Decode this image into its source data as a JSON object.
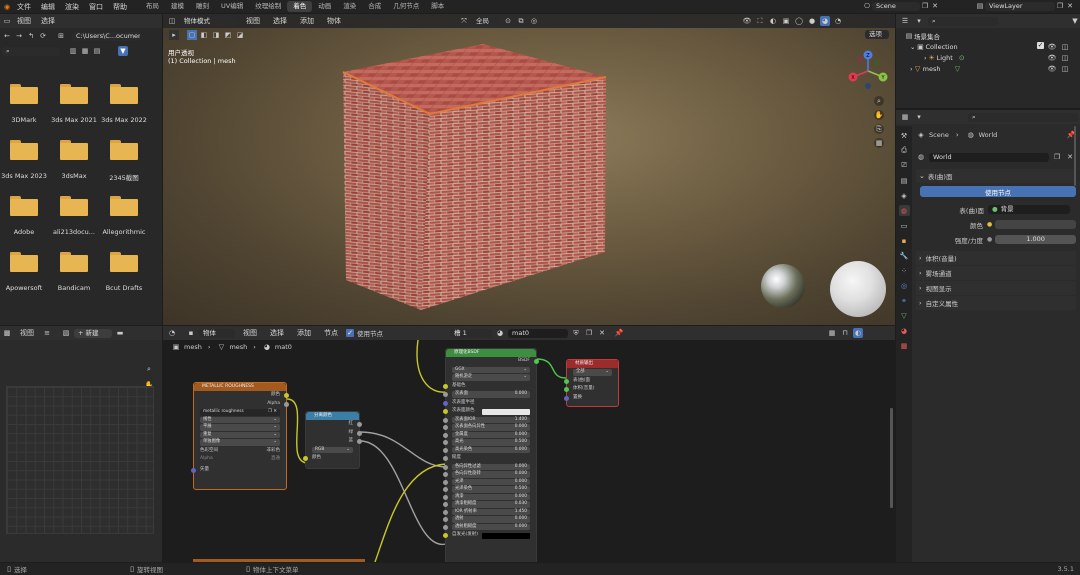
{
  "topbar": {
    "menus": [
      "文件",
      "编辑",
      "渲染",
      "窗口",
      "帮助"
    ],
    "workspaces": [
      "布局",
      "建模",
      "雕刻",
      "UV编辑",
      "纹理绘制",
      "着色",
      "动画",
      "渲染",
      "合成",
      "几何节点",
      "脚本"
    ],
    "active_workspace_index": 5,
    "scene": "Scene",
    "view_layer": "ViewLayer"
  },
  "file_browser": {
    "header_items": [
      "视图",
      "选择"
    ],
    "path": "C:\\Users\\C...ocuments\\",
    "folders": [
      "3DMark",
      "3ds Max 2021",
      "3ds Max 2022",
      "3ds Max 2023",
      "3dsMax",
      "2345截图",
      "Adobe",
      "ali213docu...",
      "Allegorithmic",
      "Apowersoft",
      "Bandicam",
      "Bcut Drafts"
    ]
  },
  "image_editor": {
    "view_label": "视图",
    "new_button": "+ 新建"
  },
  "viewport": {
    "mode": "物体模式",
    "menus": [
      "视图",
      "选择",
      "添加",
      "物体"
    ],
    "global": "全局",
    "options": "选项",
    "overlay_title": "用户透视",
    "overlay_sub": "(1) Collection | mesh",
    "gizmo": {
      "x": "X",
      "y": "Y",
      "z": "Z"
    }
  },
  "outliner": {
    "title": "场景集合",
    "items": [
      {
        "label": "Collection",
        "level": 0
      },
      {
        "label": "Light",
        "level": 1
      },
      {
        "label": "mesh",
        "level": 1
      }
    ]
  },
  "properties": {
    "breadcrumb": [
      "Scene",
      "World"
    ],
    "world_name": "World",
    "surface_section": "表(曲)面",
    "use_nodes_button": "使用节点",
    "surface_label": "表(曲)面",
    "surface_value": "背景",
    "color_label": "颜色",
    "strength_label": "强度/力度",
    "strength_value": "1.000",
    "sections": [
      "体积(音量)",
      "雾场通道",
      "视图显示",
      "自定义属性"
    ]
  },
  "node_editor": {
    "type": "物体",
    "menus": [
      "视图",
      "选择",
      "添加",
      "节点"
    ],
    "use_nodes": "使用节点",
    "slot": "槽 1",
    "material": "mat0",
    "breadcrumb": [
      "mesh",
      "mesh",
      "mat0"
    ],
    "nodes": {
      "metallic": {
        "title": "METALLIC ROUGHNESS",
        "outputs": [
          "颜色",
          "Alpha"
        ],
        "image": "metallic roughness",
        "rows": [
          "线性",
          "平展",
          "重复",
          "单独图像"
        ],
        "colorspace_label": "色彩空间",
        "colorspace_value": "非彩色",
        "alpha_label": "Alpha",
        "alpha_value": "直通",
        "input": "矢量"
      },
      "separate": {
        "title": "分离颜色",
        "outputs": [
          "红",
          "绿",
          "蓝"
        ],
        "mode": "RGB",
        "input": "颜色"
      },
      "bsdf": {
        "title": "原理化BSDF",
        "output": "BSDF",
        "dist": "GGX",
        "sss": "随机游走",
        "rows": [
          {
            "label": "基础色",
            "value": ""
          },
          {
            "label": "次表面",
            "value": "0.000"
          },
          {
            "label": "次表面半径",
            "value": ""
          },
          {
            "label": "次表面颜色",
            "value": ""
          },
          {
            "label": "次表面IOR",
            "value": "1.400"
          },
          {
            "label": "次表面各向异性",
            "value": "0.000"
          },
          {
            "label": "金属度",
            "value": "0.000"
          },
          {
            "label": "高光",
            "value": "0.500"
          },
          {
            "label": "高光染色",
            "value": "0.000"
          },
          {
            "label": "糙度",
            "value": ""
          },
          {
            "label": "各向异性过滤",
            "value": "0.000"
          },
          {
            "label": "各向异性旋转",
            "value": "0.000"
          },
          {
            "label": "光泽",
            "value": "0.000"
          },
          {
            "label": "光泽染色",
            "value": "0.500"
          },
          {
            "label": "清漆",
            "value": "0.000"
          },
          {
            "label": "清漆粗糙度",
            "value": "0.030"
          },
          {
            "label": "IOR 折射率",
            "value": "1.450"
          },
          {
            "label": "透射",
            "value": "0.000"
          },
          {
            "label": "透射粗糙度",
            "value": "0.000"
          },
          {
            "label": "自发光(发射)",
            "value": ""
          }
        ]
      },
      "output": {
        "title": "材质输出",
        "target": "全部",
        "inputs": [
          "表(曲)面",
          "体积(音量)",
          "置换"
        ]
      }
    }
  },
  "status_bar": {
    "left": "选择",
    "middle": "旋转视图",
    "context": "物体上下文菜单",
    "version": "3.5.1"
  },
  "colors": {
    "accent": "#4772b3",
    "active_ws": "#3f3f3f",
    "node_image": "#a35a1f",
    "node_converter": "#3b7fa7",
    "node_shader": "#3b8f3e",
    "node_output": "#9c2b2b"
  }
}
